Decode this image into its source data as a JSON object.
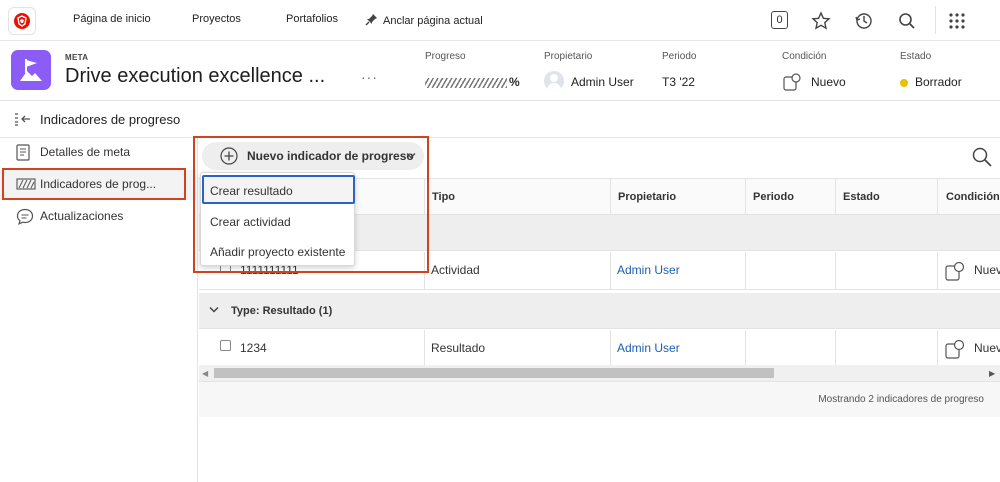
{
  "nav": {
    "links": [
      "Página de inicio",
      "Proyectos",
      "Portafolios",
      "Anclar página actual"
    ],
    "counter": "0",
    "icons": [
      "star-icon",
      "history-icon",
      "search-icon",
      "apps-grid-icon"
    ]
  },
  "header": {
    "kicker": "META",
    "title": "Drive execution excellence ...",
    "more": "···",
    "fields": {
      "progress": {
        "label": "Progreso",
        "value": "%"
      },
      "owner": {
        "label": "Propietario",
        "value": "Admin User"
      },
      "period": {
        "label": "Periodo",
        "value": "T3 '22"
      },
      "condition": {
        "label": "Condición",
        "value": "Nuevo"
      },
      "status": {
        "label": "Estado",
        "value": "Borrador",
        "color": "#e8c100"
      }
    }
  },
  "section": {
    "title": "Indicadores de progreso"
  },
  "sidebar": {
    "items": [
      {
        "label": "Detalles de meta"
      },
      {
        "label": "Indicadores de prog..."
      },
      {
        "label": "Actualizaciones"
      }
    ]
  },
  "toolbar": {
    "new_label": "Nuevo indicador de progreso"
  },
  "dropdown": {
    "items": [
      "Crear resultado",
      "Crear actividad",
      "Añadir proyecto existente"
    ]
  },
  "table": {
    "columns": [
      "Tipo",
      "Propietario",
      "Periodo",
      "Estado",
      "Condición"
    ],
    "rows_activity": [
      {
        "name": "1111111111",
        "type": "Actividad",
        "owner": "Admin User",
        "condition": "Nuev"
      }
    ],
    "group_result": {
      "label": "Type: Resultado (1)"
    },
    "rows_result": [
      {
        "name": "1234",
        "type": "Resultado",
        "owner": "Admin User",
        "condition": "Nuev"
      }
    ]
  },
  "footer": {
    "text": "Mostrando 2 indicadores de progreso"
  },
  "colors": {
    "accent": "#d4411f",
    "brand": "#eb1000",
    "goal_icon": "#8b5cf6",
    "link": "#1a5fb4"
  }
}
